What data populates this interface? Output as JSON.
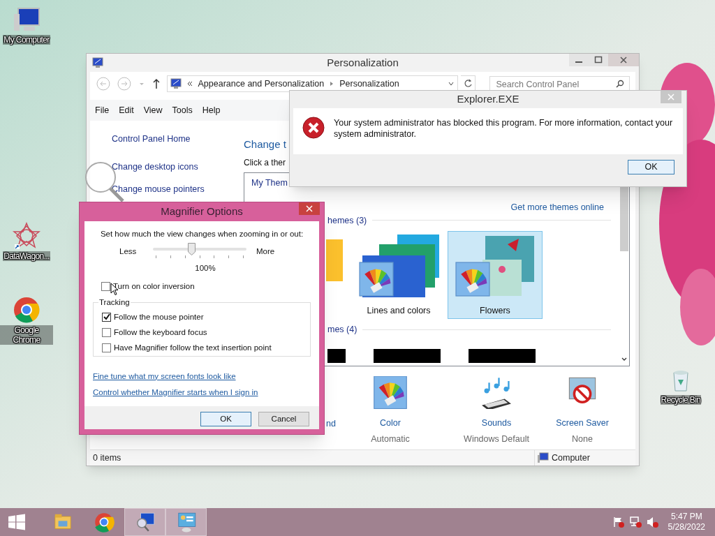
{
  "desktop_icons": [
    {
      "label": "My Computer",
      "kind": "computer"
    },
    {
      "label": "DataWagon...",
      "kind": "datawagon"
    },
    {
      "label": "Google Chrome",
      "kind": "chrome"
    },
    {
      "label": "Recycle Bin",
      "kind": "recycle"
    }
  ],
  "personalization": {
    "title": "Personalization",
    "address": [
      "Appearance and Personalization",
      "Personalization"
    ],
    "search": {
      "placeholder": "Search Control Panel"
    },
    "menu": [
      "File",
      "Edit",
      "View",
      "Tools",
      "Help"
    ],
    "sidebar": [
      "Control Panel Home",
      "Change desktop icons",
      "Change mouse pointers"
    ],
    "heading": "Change t",
    "instructions": "Click a ther",
    "themes": {
      "my_themes": "My Them",
      "online_link": "Get more themes online",
      "groups": [
        {
          "heading": "hemes (3)",
          "items": [
            {
              "label": "Lines and colors",
              "kind": "lines",
              "selected": false
            },
            {
              "label": "Flowers",
              "kind": "flowers",
              "selected": true
            }
          ]
        },
        {
          "heading": "mes (4)"
        }
      ]
    },
    "settings": [
      {
        "label": "nd",
        "kind": "background"
      },
      {
        "label": "Color",
        "value": "Automatic",
        "kind": "color"
      },
      {
        "label": "Sounds",
        "value": "Windows Default",
        "kind": "sounds"
      },
      {
        "label": "Screen Saver",
        "value": "None",
        "kind": "screensaver"
      }
    ],
    "status_bar": {
      "items": "0 items",
      "location": "Computer"
    }
  },
  "error_dialog": {
    "title": "Explorer.EXE",
    "message": "Your system administrator has blocked this program. For more information, contact your system administrator.",
    "button": "OK"
  },
  "magnifier_options": {
    "title": "Magnifier Options",
    "prompt": "Set how much the view changes when zooming in or out:",
    "slider": {
      "less": "Less",
      "more": "More",
      "level": 0.41,
      "reading": "100%"
    },
    "color_inversion": {
      "label": "Turn on color inversion",
      "checked": false
    },
    "tracking": {
      "legend": "Tracking",
      "options": [
        {
          "label": "Follow the mouse pointer",
          "checked": true
        },
        {
          "label": "Follow the keyboard focus",
          "checked": false
        },
        {
          "label": "Have Magnifier follow the text insertion point",
          "checked": false
        }
      ]
    },
    "links": [
      "Fine tune what my screen fonts look like",
      "Control whether Magnifier starts when I sign in"
    ],
    "buttons": [
      {
        "label": "OK",
        "default": true
      },
      {
        "label": "Cancel",
        "default": false
      }
    ]
  },
  "taskbar": {
    "apps": [
      {
        "kind": "explorer",
        "running": false
      },
      {
        "kind": "chrome",
        "running": false
      },
      {
        "kind": "magnifier",
        "running": true
      },
      {
        "kind": "controlpanel",
        "running": true
      }
    ],
    "clock": {
      "time": "5:47 PM",
      "date": "5/28/2022"
    }
  }
}
